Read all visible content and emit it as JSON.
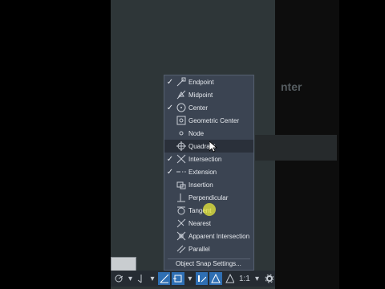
{
  "canvas_bg_text": "nter",
  "menu": {
    "items": [
      {
        "label": "Endpoint",
        "checked": true,
        "icon": "endpoint-icon"
      },
      {
        "label": "Midpoint",
        "checked": false,
        "icon": "midpoint-icon"
      },
      {
        "label": "Center",
        "checked": true,
        "icon": "center-icon"
      },
      {
        "label": "Geometric Center",
        "checked": false,
        "icon": "geometric-center-icon"
      },
      {
        "label": "Node",
        "checked": false,
        "icon": "node-icon"
      },
      {
        "label": "Quadrant",
        "checked": false,
        "icon": "quadrant-icon"
      },
      {
        "label": "Intersection",
        "checked": true,
        "icon": "intersection-icon"
      },
      {
        "label": "Extension",
        "checked": true,
        "icon": "extension-icon"
      },
      {
        "label": "Insertion",
        "checked": false,
        "icon": "insertion-icon"
      },
      {
        "label": "Perpendicular",
        "checked": false,
        "icon": "perpendicular-icon"
      },
      {
        "label": "Tangent",
        "checked": false,
        "icon": "tangent-icon"
      },
      {
        "label": "Nearest",
        "checked": false,
        "icon": "nearest-icon"
      },
      {
        "label": "Apparent Intersection",
        "checked": false,
        "icon": "apparent-intersection-icon"
      },
      {
        "label": "Parallel",
        "checked": false,
        "icon": "parallel-icon"
      }
    ],
    "settings_label": "Object Snap Settings..."
  },
  "status_bar": {
    "scale_label": "1:1",
    "check_glyph": "✓",
    "dropdown_glyph": "▾"
  }
}
